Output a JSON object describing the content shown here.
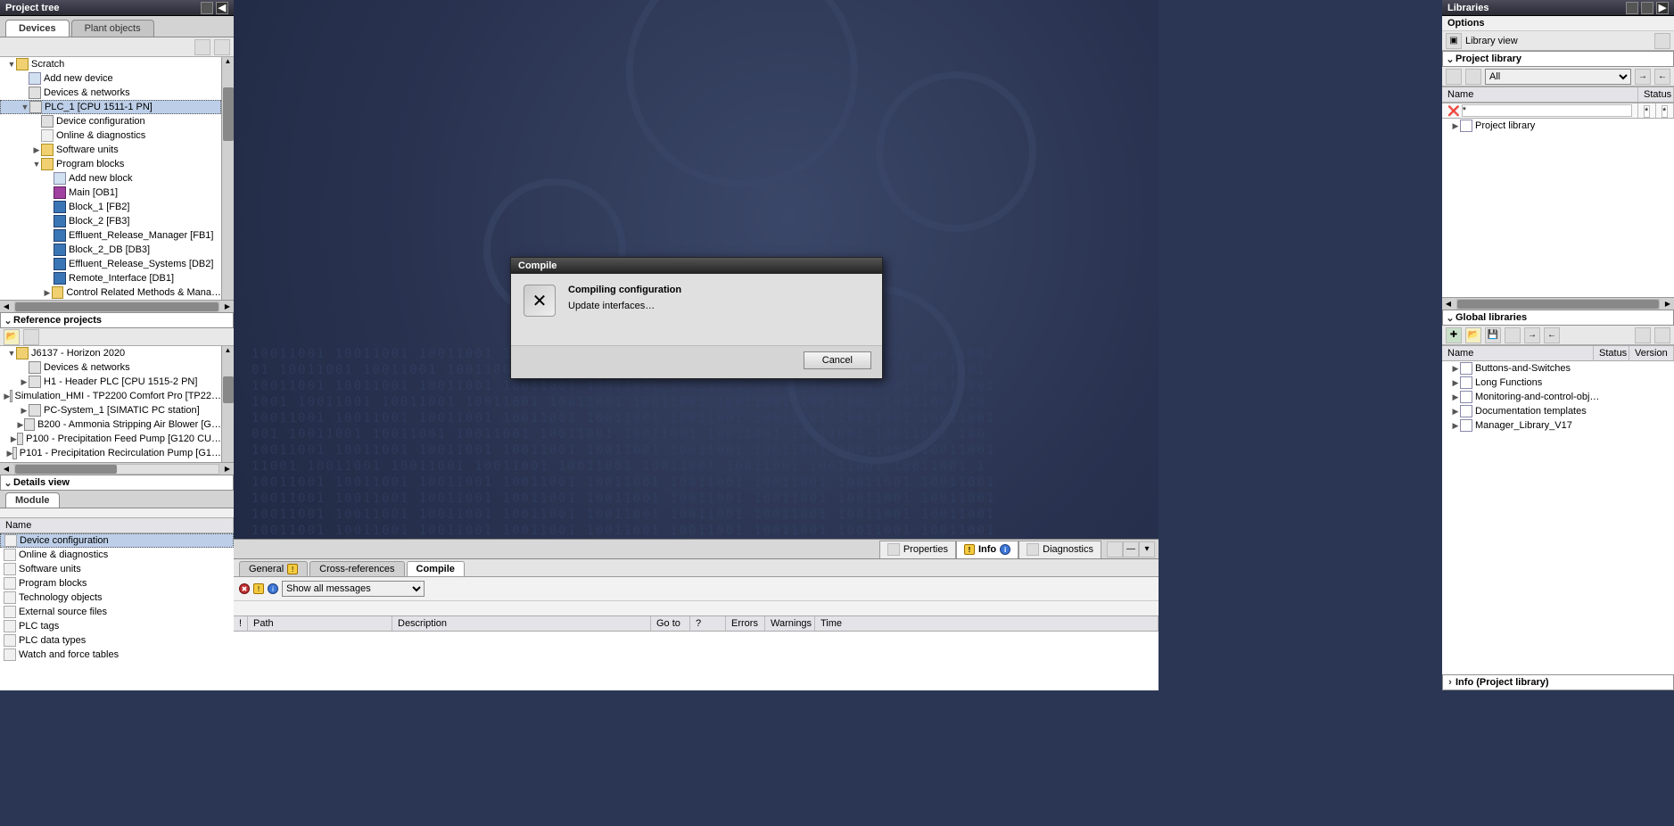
{
  "left": {
    "title": "Project tree",
    "tabs": {
      "devices": "Devices",
      "plant_objects": "Plant objects"
    },
    "tree": [
      {
        "d": 0,
        "exp": "▼",
        "ico": "ic-folder",
        "label": "Scratch"
      },
      {
        "d": 1,
        "exp": "",
        "ico": "ic-add",
        "label": "Add new device"
      },
      {
        "d": 1,
        "exp": "",
        "ico": "ic-dev",
        "label": "Devices & networks"
      },
      {
        "d": 1,
        "exp": "▼",
        "ico": "ic-plc",
        "label": "PLC_1 [CPU 1511-1 PN]",
        "sel": true
      },
      {
        "d": 2,
        "exp": "",
        "ico": "ic-plc",
        "label": "Device configuration"
      },
      {
        "d": 2,
        "exp": "",
        "ico": "ic-od",
        "label": "Online & diagnostics"
      },
      {
        "d": 2,
        "exp": "▶",
        "ico": "ic-folder",
        "label": "Software units"
      },
      {
        "d": 2,
        "exp": "▼",
        "ico": "ic-folder",
        "label": "Program blocks"
      },
      {
        "d": 3,
        "exp": "",
        "ico": "ic-add",
        "label": "Add new block"
      },
      {
        "d": 3,
        "exp": "",
        "ico": "ic-ob",
        "label": "Main [OB1]"
      },
      {
        "d": 3,
        "exp": "",
        "ico": "ic-block",
        "label": "Block_1 [FB2]"
      },
      {
        "d": 3,
        "exp": "",
        "ico": "ic-block",
        "label": "Block_2 [FB3]"
      },
      {
        "d": 3,
        "exp": "",
        "ico": "ic-block",
        "label": "Effluent_Release_Manager [FB1]"
      },
      {
        "d": 3,
        "exp": "",
        "ico": "ic-db",
        "label": "Block_2_DB [DB3]"
      },
      {
        "d": 3,
        "exp": "",
        "ico": "ic-db",
        "label": "Effluent_Release_Systems [DB2]"
      },
      {
        "d": 3,
        "exp": "",
        "ico": "ic-db",
        "label": "Remote_Interface [DB1]"
      },
      {
        "d": 3,
        "exp": "▶",
        "ico": "ic-folder",
        "label": "Control Related Methods & Mana…"
      }
    ],
    "ref_title": "Reference projects",
    "ref_tree": [
      {
        "d": 0,
        "exp": "▼",
        "ico": "ic-folder",
        "label": "J6137 - Horizon 2020"
      },
      {
        "d": 1,
        "exp": "",
        "ico": "ic-dev",
        "label": "Devices & networks"
      },
      {
        "d": 1,
        "exp": "▶",
        "ico": "ic-plc",
        "label": "H1 - Header PLC [CPU 1515-2 PN]"
      },
      {
        "d": 1,
        "exp": "▶",
        "ico": "ic-plc",
        "label": "Simulation_HMI - TP2200 Comfort Pro [TP22…"
      },
      {
        "d": 1,
        "exp": "▶",
        "ico": "ic-plc",
        "label": "PC-System_1 [SIMATIC PC station]"
      },
      {
        "d": 1,
        "exp": "▶",
        "ico": "ic-plc",
        "label": "B200 - Ammonia Stripping Air Blower [G…"
      },
      {
        "d": 1,
        "exp": "▶",
        "ico": "ic-plc",
        "label": "P100 - Precipitation Feed Pump [G120 CU…"
      },
      {
        "d": 1,
        "exp": "▶",
        "ico": "ic-plc",
        "label": "P101 - Precipitation Recirculation Pump [G1…"
      }
    ],
    "details_title": "Details view",
    "details_tab": "Module",
    "details_name_col": "Name",
    "details_items": [
      "Device configuration",
      "Online & diagnostics",
      "Software units",
      "Program blocks",
      "Technology objects",
      "External source files",
      "PLC tags",
      "PLC data types",
      "Watch and force tables"
    ]
  },
  "right": {
    "title": "Libraries",
    "options": "Options",
    "library_view": "Library view",
    "proj_lib": "Project library",
    "filter_all": "All",
    "name_col": "Name",
    "status_col": "Status",
    "proj_lib_item": "Project library",
    "global_title": "Global libraries",
    "global_cols": {
      "name": "Name",
      "status": "Status",
      "version": "Version"
    },
    "global_items": [
      "Buttons-and-Switches",
      "Long Functions",
      "Monitoring-and-control-obj…",
      "Documentation templates",
      "Manager_Library_V17"
    ],
    "info_footer": "Info (Project library)"
  },
  "info": {
    "prop_tabs": {
      "properties": "Properties",
      "info": "Info",
      "diagnostics": "Diagnostics"
    },
    "top_tabs": {
      "general": "General",
      "cross": "Cross-references",
      "compile": "Compile"
    },
    "filter": "Show all messages",
    "cols": {
      "bang": "!",
      "path": "Path",
      "desc": "Description",
      "goto": "Go to",
      "q": "?",
      "errors": "Errors",
      "warnings": "Warnings",
      "time": "Time"
    }
  },
  "dialog": {
    "title": "Compile",
    "heading": "Compiling configuration",
    "status": "Update interfaces…",
    "cancel": "Cancel"
  }
}
